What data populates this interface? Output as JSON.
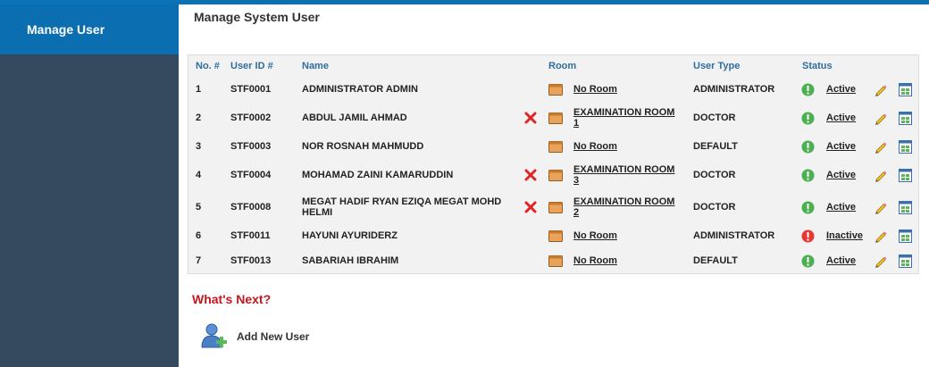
{
  "sidebar": {
    "active_item": "Manage User"
  },
  "page": {
    "title": "Manage System User"
  },
  "table": {
    "headers": {
      "no": "No. #",
      "user_id": "User ID #",
      "name": "Name",
      "room": "Room",
      "user_type": "User Type",
      "status": "Status"
    },
    "rows": [
      {
        "no": "1",
        "user_id": "STF0001",
        "name_l1": "ADMINISTRATOR ADMIN",
        "name_l2": "",
        "room_l1": "No Room",
        "room_l2": "",
        "user_type": "ADMINISTRATOR",
        "status": "Active",
        "removable": false
      },
      {
        "no": "2",
        "user_id": "STF0002",
        "name_l1": "ABDUL JAMIL AHMAD",
        "name_l2": "",
        "room_l1": "EXAMINATION ROOM",
        "room_l2": "1",
        "user_type": "DOCTOR",
        "status": "Active",
        "removable": true
      },
      {
        "no": "3",
        "user_id": "STF0003",
        "name_l1": "NOR ROSNAH MAHMUDD",
        "name_l2": "",
        "room_l1": "No Room",
        "room_l2": "",
        "user_type": "DEFAULT",
        "status": "Active",
        "removable": false
      },
      {
        "no": "4",
        "user_id": "STF0004",
        "name_l1": "MOHAMAD ZAINI KAMARUDDIN",
        "name_l2": "",
        "room_l1": "EXAMINATION ROOM",
        "room_l2": "3",
        "user_type": "DOCTOR",
        "status": "Active",
        "removable": true
      },
      {
        "no": "5",
        "user_id": "STF0008",
        "name_l1": "MEGAT HADIF RYAN EZIQA MEGAT MOHD",
        "name_l2": "HELMI",
        "room_l1": "EXAMINATION ROOM",
        "room_l2": "2",
        "user_type": "DOCTOR",
        "status": "Active",
        "removable": true
      },
      {
        "no": "6",
        "user_id": "STF0011",
        "name_l1": "HAYUNI AYURIDERZ",
        "name_l2": "",
        "room_l1": "No Room",
        "room_l2": "",
        "user_type": "ADMINISTRATOR",
        "status": "Inactive",
        "removable": false
      },
      {
        "no": "7",
        "user_id": "STF0013",
        "name_l1": "SABARIAH IBRAHIM",
        "name_l2": "",
        "room_l1": "No Room",
        "room_l2": "",
        "user_type": "DEFAULT",
        "status": "Active",
        "removable": false
      }
    ]
  },
  "whats_next": {
    "title": "What's Next?",
    "add_user_label": "Add New User"
  },
  "icons": {
    "remove": "remove-x-icon",
    "room": "room-icon",
    "active": "status-active-icon",
    "inactive": "status-inactive-icon",
    "edit": "pencil-edit-icon",
    "details": "details-grid-icon"
  },
  "colors": {
    "topbar": "#0a73b8",
    "sidebar": "#35495e",
    "sidebar_active": "#0a6eb0",
    "header_text": "#2e6e9e",
    "active_green": "#4caf50",
    "inactive_red": "#e53935",
    "whats_next": "#c4161c"
  }
}
